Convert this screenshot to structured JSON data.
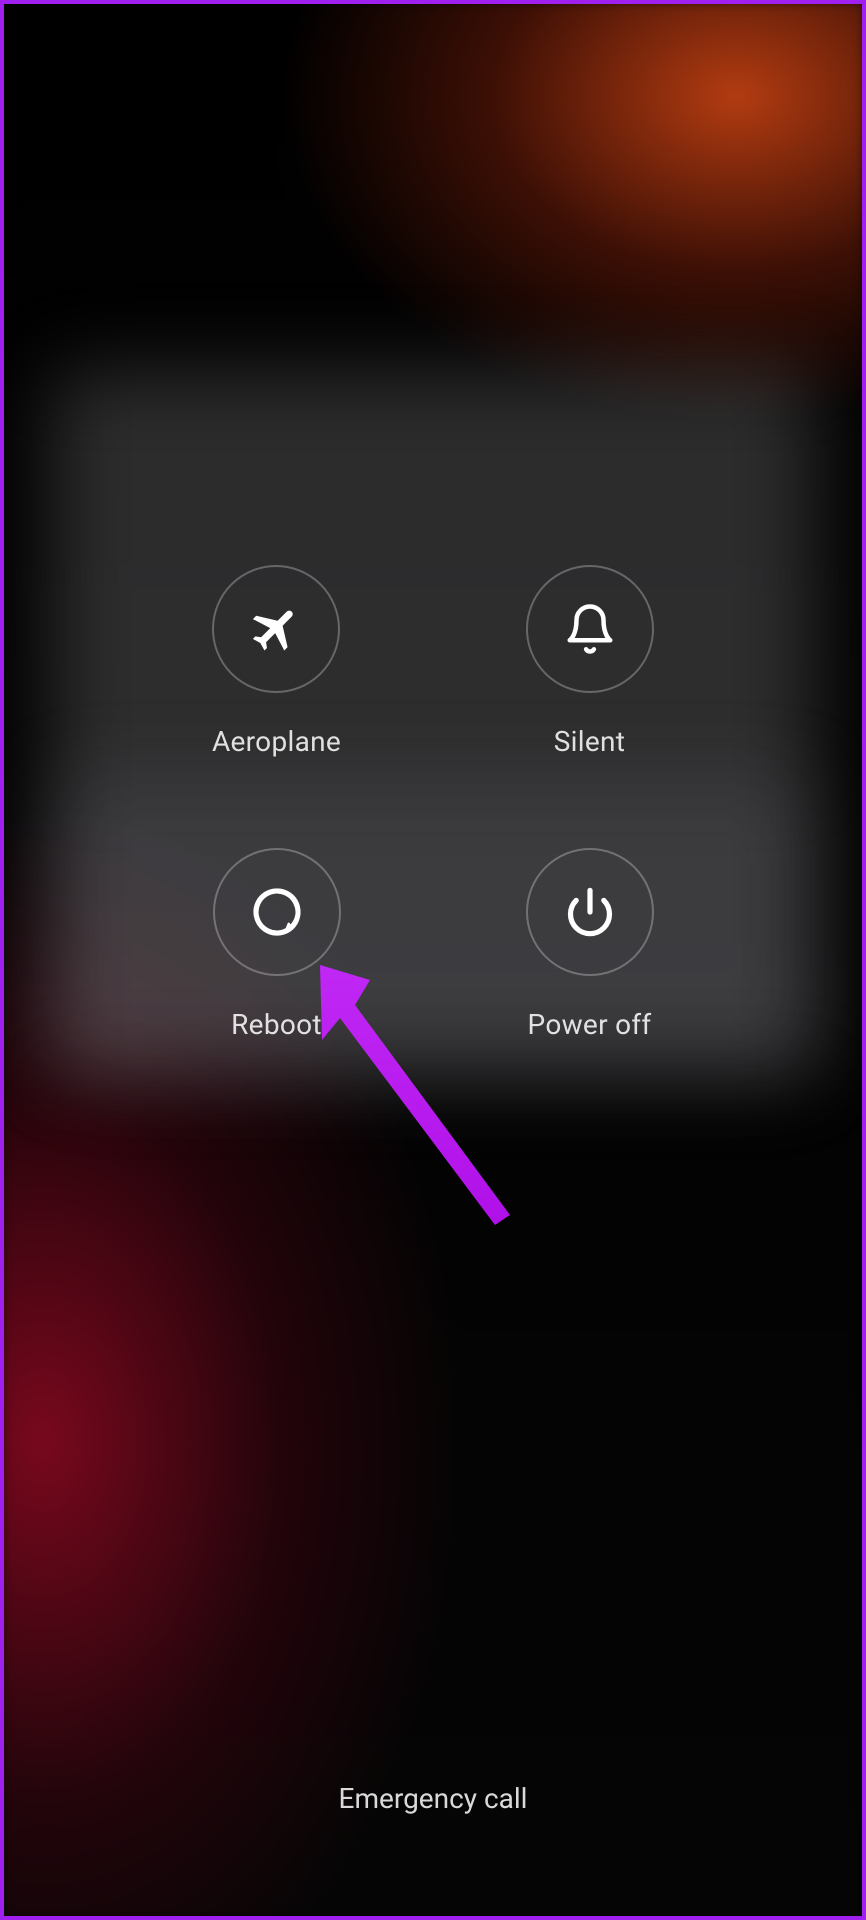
{
  "menu": {
    "aeroplane": {
      "label": "Aeroplane",
      "icon": "airplane-icon"
    },
    "silent": {
      "label": "Silent",
      "icon": "bell-icon"
    },
    "reboot": {
      "label": "Reboot",
      "icon": "restart-icon"
    },
    "poweroff": {
      "label": "Power off",
      "icon": "power-icon"
    }
  },
  "emergency_label": "Emergency call",
  "annotation": {
    "arrow_color": "#c028f5"
  }
}
